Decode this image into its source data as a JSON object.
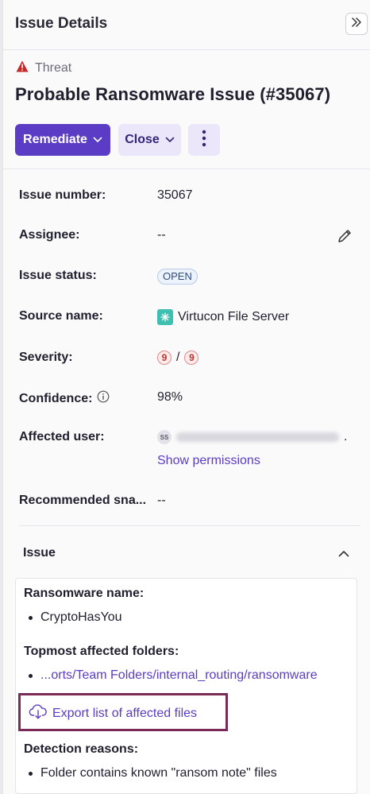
{
  "header": {
    "title": "Issue Details"
  },
  "issue": {
    "type": "Threat",
    "title": "Probable Ransomware Issue (#35067)"
  },
  "actions": {
    "remediate_label": "Remediate",
    "close_label": "Close"
  },
  "details": {
    "issue_number": {
      "label": "Issue number:",
      "value": "35067"
    },
    "assignee": {
      "label": "Assignee:",
      "value": "--"
    },
    "issue_status": {
      "label": "Issue status:",
      "value": "OPEN"
    },
    "source_name": {
      "label": "Source name:",
      "value": "Virtucon File Server"
    },
    "severity": {
      "label": "Severity:",
      "value": "9",
      "max": "9",
      "separator": "/"
    },
    "confidence": {
      "label": "Confidence:",
      "value": "98%"
    },
    "affected_user": {
      "label": "Affected user:",
      "avatar_initials": "SS",
      "trailing": ".",
      "permissions_link": "Show permissions"
    },
    "recommended_snapshot": {
      "label": "Recommended sna...",
      "value": "--"
    }
  },
  "issue_section": {
    "title": "Issue",
    "ransomware_name_heading": "Ransomware name:",
    "ransomware_name": "CryptoHasYou",
    "folders_heading": "Topmost affected folders:",
    "folder_path": "...orts/Team Folders/internal_routing/ransomware",
    "export_label": "Export list of affected files",
    "detection_heading": "Detection reasons:",
    "detection_reason": "Folder contains known \"ransom note\" files"
  },
  "colors": {
    "accent": "#5b3cc4",
    "threat": "#c62828",
    "highlight_border": "#7a2a56"
  },
  "icons": [
    "warning-icon",
    "chevron-down-icon",
    "more-vertical-icon",
    "double-chevron-right-icon",
    "pencil-icon",
    "info-icon",
    "file-server-icon",
    "chevron-up-icon",
    "cloud-download-icon"
  ]
}
